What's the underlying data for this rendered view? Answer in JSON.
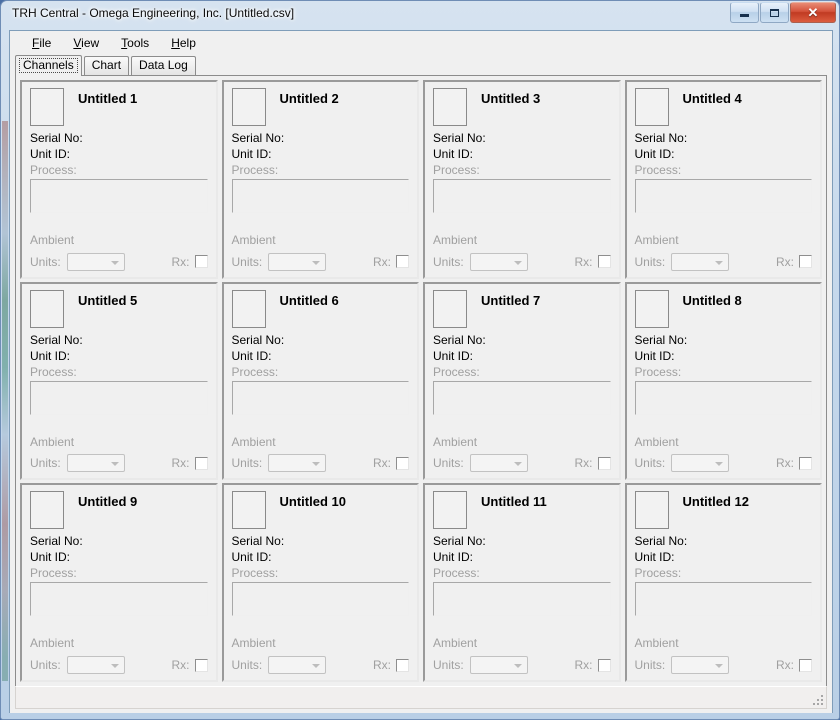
{
  "window": {
    "title": "TRH Central - Omega Engineering, Inc. [Untitled.csv]",
    "minimize_label": "Minimize",
    "maximize_label": "Restore",
    "close_label": "✕"
  },
  "menu": [
    {
      "pre": "",
      "accel": "F",
      "post": "ile"
    },
    {
      "pre": "",
      "accel": "V",
      "post": "iew"
    },
    {
      "pre": "",
      "accel": "T",
      "post": "ools"
    },
    {
      "pre": "",
      "accel": "H",
      "post": "elp"
    }
  ],
  "tabs": [
    {
      "label": "Channels",
      "active": true
    },
    {
      "label": "Chart",
      "active": false
    },
    {
      "label": "Data Log",
      "active": false
    }
  ],
  "panel_labels": {
    "serial": "Serial No:",
    "unit_id": "Unit ID:",
    "process": "Process:",
    "ambient": "Ambient",
    "units": "Units:",
    "rx": "Rx:",
    "units_value": "",
    "process_value": "",
    "serial_value": "",
    "unit_id_value": "",
    "ambient_value": ""
  },
  "channels": [
    {
      "title": "Untitled 1"
    },
    {
      "title": "Untitled 2"
    },
    {
      "title": "Untitled 3"
    },
    {
      "title": "Untitled 4"
    },
    {
      "title": "Untitled 5"
    },
    {
      "title": "Untitled 6"
    },
    {
      "title": "Untitled 7"
    },
    {
      "title": "Untitled 8"
    },
    {
      "title": "Untitled 9"
    },
    {
      "title": "Untitled 10"
    },
    {
      "title": "Untitled 11"
    },
    {
      "title": "Untitled 12"
    }
  ],
  "statusbar": {
    "text": ""
  },
  "colors": {
    "frame": "#b9cfe6",
    "client": "#f0f0f0",
    "close_button": "#c03a22",
    "disabled_text": "#a0a0a0"
  }
}
